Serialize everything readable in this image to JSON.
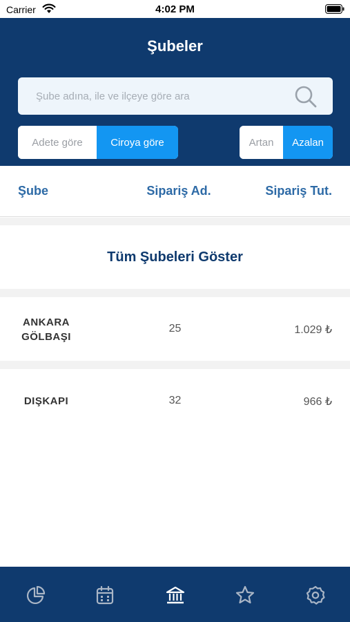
{
  "status_bar": {
    "carrier": "Carrier",
    "time": "4:02 PM"
  },
  "header": {
    "title": "Şubeler",
    "background_color": "#0f3a6e"
  },
  "search": {
    "placeholder": "Şube adına, ile ve ilçeye göre ara",
    "value": ""
  },
  "sort_by": {
    "options": [
      "Adete göre",
      "Ciroya göre"
    ],
    "selected": "Ciroya göre"
  },
  "sort_order": {
    "options": [
      "Artan",
      "Azalan"
    ],
    "selected": "Azalan"
  },
  "accent_color": "#1396f2",
  "table": {
    "columns": [
      "Şube",
      "Sipariş Ad.",
      "Sipariş Tut."
    ],
    "show_all_label": "Tüm Şubeleri Göster",
    "rows": [
      {
        "name": "ANKARA GÖLBAŞI",
        "count": "25",
        "amount": "1.029 ₺"
      },
      {
        "name": "DIŞKAPI",
        "count": "32",
        "amount": "966 ₺"
      }
    ]
  },
  "tab_bar": {
    "icons": [
      "pie-chart-icon",
      "calendar-icon",
      "bank-icon",
      "star-icon",
      "settings-icon"
    ],
    "selected": "bank-icon"
  }
}
